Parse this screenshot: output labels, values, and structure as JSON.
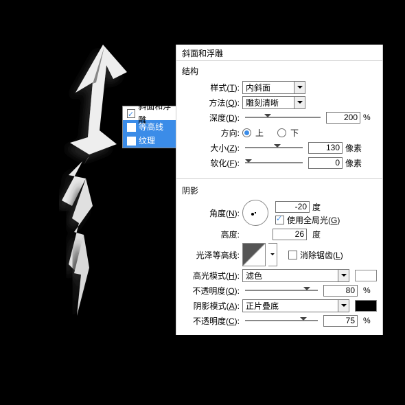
{
  "canvas_shape": "lightning-effect",
  "sidebar": {
    "items": [
      {
        "label": "斜面和浮雕",
        "checked": true,
        "selected": false
      },
      {
        "label": "等高线",
        "checked": false,
        "selected": true
      },
      {
        "label": "纹理",
        "checked": false,
        "selected": true
      }
    ]
  },
  "panel": {
    "title": "斜面和浮雕",
    "structure": {
      "heading": "结构",
      "style_label": "样式(T):",
      "style_value": "内斜面",
      "method_label": "方法(Q):",
      "method_value": "雕刻清晰",
      "depth_label": "深度(D):",
      "depth_value": "200",
      "depth_unit": "%",
      "direction_label": "方向:",
      "dir_up": "上",
      "dir_down": "下",
      "dir_selected": "up",
      "size_label": "大小(Z):",
      "size_value": "130",
      "size_unit": "像素",
      "soften_label": "软化(F):",
      "soften_value": "0",
      "soften_unit": "像素"
    },
    "shading": {
      "heading": "阴影",
      "angle_label": "角度(N):",
      "angle_value": "-20",
      "angle_unit": "度",
      "global_light_label": "使用全局光(G)",
      "global_light_checked": true,
      "altitude_label": "高度:",
      "altitude_value": "26",
      "altitude_unit": "度",
      "gloss_contour_label": "光泽等高线:",
      "antialias_label": "消除锯齿(L)",
      "antialias_checked": false,
      "highlight_mode_label": "高光模式(H):",
      "highlight_mode_value": "滤色",
      "highlight_color": "#ffffff",
      "highlight_opacity_label": "不透明度(O):",
      "highlight_opacity_value": "80",
      "highlight_opacity_unit": "%",
      "shadow_mode_label": "阴影模式(A):",
      "shadow_mode_value": "正片叠底",
      "shadow_color": "#000000",
      "shadow_opacity_label": "不透明度(C):",
      "shadow_opacity_value": "75",
      "shadow_opacity_unit": "%"
    }
  }
}
